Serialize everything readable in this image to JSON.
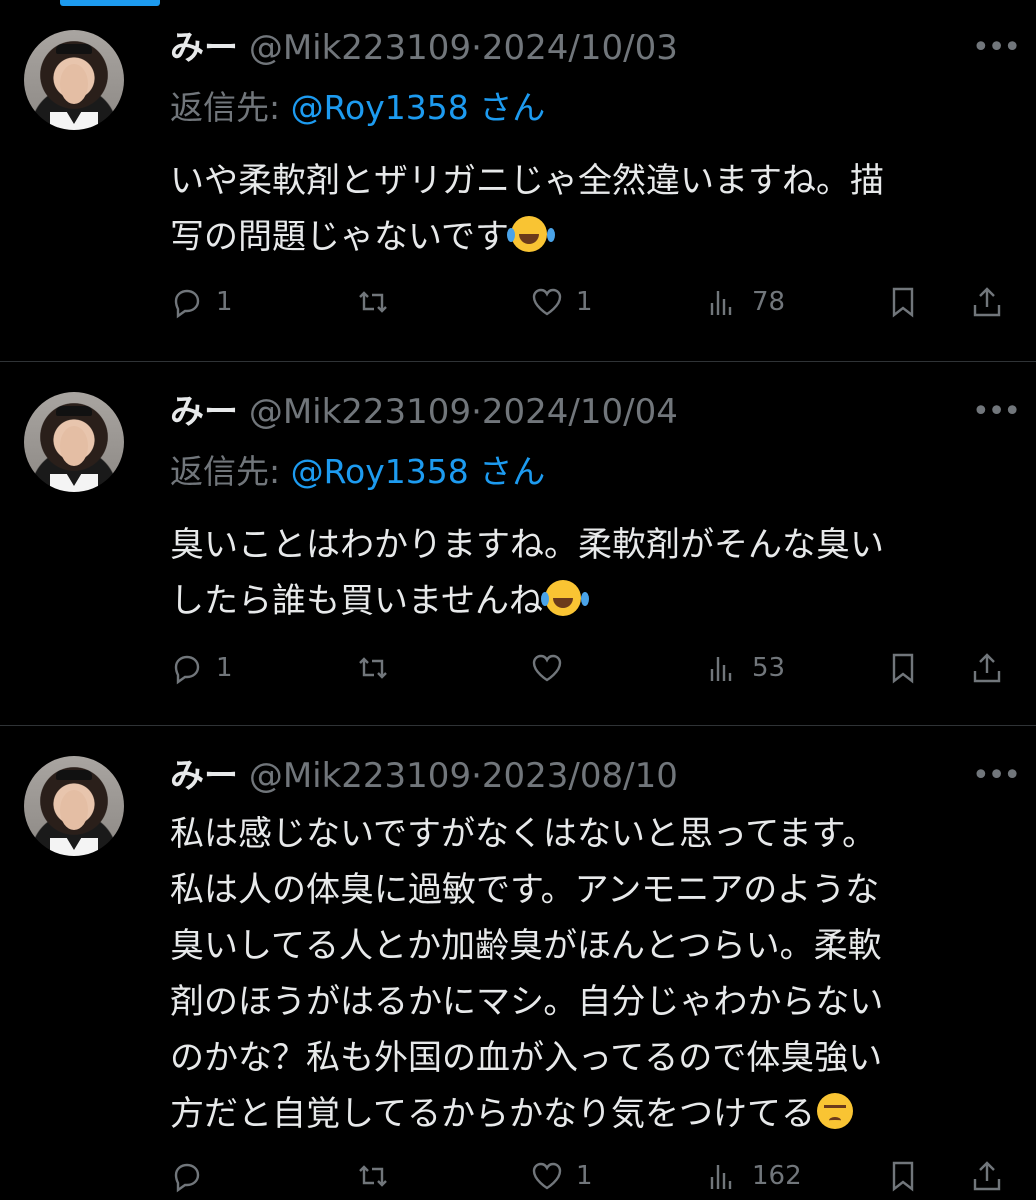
{
  "tweets": [
    {
      "name": "みー",
      "handle": "@Mik223109",
      "sep": "·",
      "date": "2024/10/03",
      "reply_prefix": "返信先: ",
      "reply_to": "@Roy1358",
      "reply_suffix": " さん",
      "lines": [
        "いや柔軟剤とザリガニじゃ全然違いますね。描",
        "写の問題じゃないです"
      ],
      "emoji": "face-with-tears-of-joy",
      "replies": "1",
      "retweets": "",
      "likes": "1",
      "views": "78"
    },
    {
      "name": "みー",
      "handle": "@Mik223109",
      "sep": "·",
      "date": "2024/10/04",
      "reply_prefix": "返信先: ",
      "reply_to": "@Roy1358",
      "reply_suffix": " さん",
      "lines": [
        "臭いことはわかりますね。柔軟剤がそんな臭い",
        "したら誰も買いませんね"
      ],
      "emoji": "face-with-tears-of-joy",
      "replies": "1",
      "retweets": "",
      "likes": "",
      "views": "53"
    },
    {
      "name": "みー",
      "handle": "@Mik223109",
      "sep": "·",
      "date": "2023/08/10",
      "lines": [
        "私は感じないですがなくはないと思ってます。",
        "私は人の体臭に過敏です。アンモニアのような",
        "臭いしてる人とか加齢臭がほんとつらい。柔軟",
        "剤のほうがはるかにマシ。自分じゃわからない",
        "のかな？私も外国の血が入ってるので体臭強い",
        "方だと自覚してるからかなり気をつけてる"
      ],
      "emoji": "pensive-face",
      "replies": "",
      "retweets": "",
      "likes": "1",
      "views": "162"
    }
  ],
  "icons": {
    "reply": "reply-icon",
    "retweet": "retweet-icon",
    "like": "heart-icon",
    "views": "views-chart-icon",
    "bookmark": "bookmark-icon",
    "share": "share-icon",
    "more": "more-dots-icon"
  },
  "colors": {
    "background": "#000000",
    "text": "#e7e9ea",
    "muted": "#71767b",
    "accent": "#1d9bf0",
    "divider": "#2f3336"
  }
}
